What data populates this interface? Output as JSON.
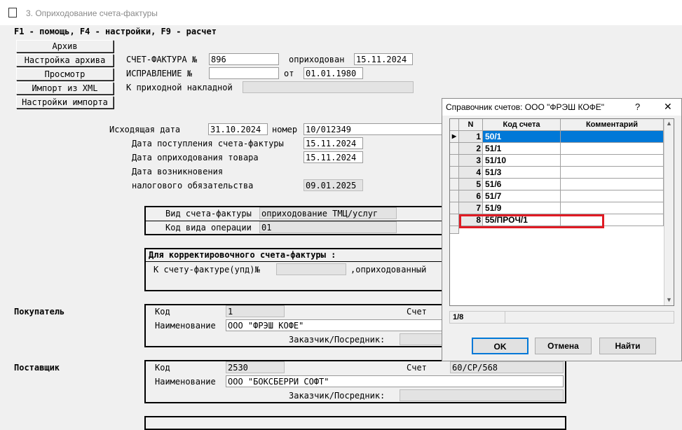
{
  "window": {
    "title": "3. Оприходование счета-фактуры"
  },
  "hotkeys": "F1 - помощь, F4 - настройки, F9 - расчет",
  "side_buttons": [
    "Архив",
    "Настройка архива",
    "Просмотр",
    "Импорт из XML",
    "Настройки импорта"
  ],
  "invoice": {
    "number_label": "СЧЕТ-ФАКТУРА №",
    "number": "896",
    "posted_label": "оприходован",
    "posted_date": "15.11.2024",
    "correction_label": "ИСПРАВЛЕНИЕ  №",
    "correction_number": "",
    "from_label": "от",
    "from_date": "01.01.1980",
    "waybill_label": "К приходной накладной",
    "waybill": ""
  },
  "outgoing": {
    "date_label": "Исходящая дата",
    "date": "31.10.2024",
    "number_label": "номер",
    "number": "10/012349",
    "received_label": "Дата поступления счета-фактуры",
    "received": "15.11.2024",
    "goods_label": "Дата оприходования товара",
    "goods": "15.11.2024",
    "origin_label_1": "Дата возникновения",
    "origin_label_2": "налогового обязательства",
    "origin": "09.01.2025"
  },
  "kind": {
    "type_label": "Вид счета-фактуры",
    "type": "оприходование ТМЦ/услуг",
    "op_label": "Код вида операции",
    "op": "01"
  },
  "correction_block": {
    "title": "Для корректировочного счета-фактуры :",
    "to_label": "К счету-фактуре(упд)№",
    "to_value": "",
    "posted_label": ",оприходованный"
  },
  "buyer": {
    "section": "Покупатель",
    "code_label": "Код",
    "code": "1",
    "account_label": "Счет",
    "name_label": "Наименование",
    "name": "ООО \"ФРЭШ КОФЕ\"",
    "agent_label": "Заказчик/Посредник:"
  },
  "supplier": {
    "section": "Поставщик",
    "code_label": "Код",
    "code": "2530",
    "account_label": "Счет",
    "account": "60/СР/568",
    "name_label": "Наименование",
    "name": "ООО \"БОКСБЕРРИ СОФТ\"",
    "agent_label": "Заказчик/Посредник:"
  },
  "dialog": {
    "title": "Справочник счетов: ООО \"ФРЭШ КОФЕ\"",
    "help": "?",
    "close": "✕",
    "columns": [
      "N",
      "Код счета",
      "Комментарий"
    ],
    "rows": [
      {
        "n": "1",
        "code": "50/1",
        "comment": ""
      },
      {
        "n": "2",
        "code": "51/1",
        "comment": ""
      },
      {
        "n": "3",
        "code": "51/10",
        "comment": ""
      },
      {
        "n": "4",
        "code": "51/3",
        "comment": ""
      },
      {
        "n": "5",
        "code": "51/6",
        "comment": ""
      },
      {
        "n": "6",
        "code": "51/7",
        "comment": ""
      },
      {
        "n": "7",
        "code": "51/9",
        "comment": ""
      },
      {
        "n": "8",
        "code": "55/ПРОЧ/1",
        "comment": ""
      }
    ],
    "status": "1/8",
    "ok": "OK",
    "cancel": "Отмена",
    "find": "Найти",
    "highlight_color": "#e01b24",
    "selection_color": "#0078d7"
  }
}
